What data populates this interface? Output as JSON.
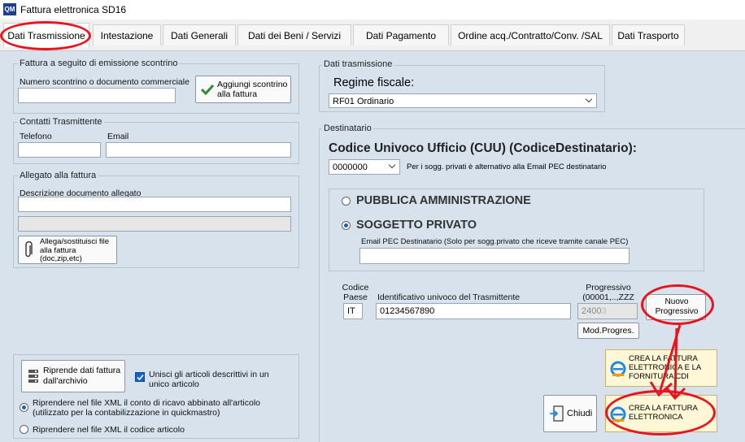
{
  "window": {
    "title": "Fattura elettronica SD16",
    "icon_text": "QM"
  },
  "tabs": [
    {
      "label": "Dati Trasmissione",
      "active": true
    },
    {
      "label": "Intestazione"
    },
    {
      "label": "Dati Generali"
    },
    {
      "label": "Dati dei Beni / Servizi"
    },
    {
      "label": "Dati Pagamento"
    },
    {
      "label": "Ordine acq./Contratto/Conv. /SAL"
    },
    {
      "label": "Dati Trasporto"
    }
  ],
  "scontrino": {
    "title": "Fattura a seguito di emissione scontrino",
    "field_label": "Numero scontrino o documento commerciale",
    "value": "",
    "button_label": "Aggiungi scontrino alla fattura"
  },
  "contatti": {
    "title": "Contatti Trasmittente",
    "telefono_label": "Telefono",
    "telefono_value": "",
    "email_label": "Email",
    "email_value": ""
  },
  "allegato": {
    "title": "Allegato alla fattura",
    "descr_label": "Descrizione documento allegato",
    "descr_value": "",
    "file_value": "",
    "button_label": "Allega/sostituisci file alla fattura (doc,zip,etc)"
  },
  "options": {
    "riprende_button": "Riprende dati fattura dall'archivio",
    "unisci_label": "Unisci gli articoli descrittivi in un unico articolo",
    "unisci_checked": true,
    "radio1_label": "Riprendere nel file XML il  conto di ricavo abbinato all'articolo (utilizzato per la contabilizzazione in quickmastro)",
    "radio1_selected": true,
    "radio2_label": "Riprendere nel file XML il codice articolo",
    "radio2_selected": false
  },
  "dati_trasmissione": {
    "title": "Dati trasmissione",
    "regime_label": "Regime fiscale:",
    "regime_value": "RF01 Ordinario"
  },
  "destinatario": {
    "title": "Destinatario",
    "cuu_label": "Codice Univoco Ufficio (CUU) (CodiceDestinatario):",
    "cuu_value": "0000000",
    "cuu_note": "Per i sogg. privati è alternativo alla Email PEC destinatario",
    "pa_label": "PUBBLICA AMMINISTRAZIONE",
    "pa_selected": false,
    "privato_label": "SOGGETTO PRIVATO",
    "privato_selected": true,
    "pec_label": "Email PEC Destinatario (Solo per sogg.privato che riceve tramite canale PEC)",
    "pec_value": ""
  },
  "trasmittente": {
    "paese_label_1": "Codice",
    "paese_label_2": "Paese",
    "paese_value": "IT",
    "id_label": "Identificativo univoco del Trasmittente",
    "id_value": "01234567890",
    "progr_label_1": "Progressivo",
    "progr_label_2": "(00001,..,ZZZ",
    "progr_value": "2400",
    "progr_value_extra": "3",
    "nuovo_button": "Nuovo Progressivo",
    "mod_button": "Mod.Progres."
  },
  "actions": {
    "crea_fornitura_button": "CREA LA FATTURA ELETTRONICA E LA FORNITURA CDI",
    "crea_button": "CREA LA FATTURA ELETTRONICA",
    "chiudi_button": "Chiudi"
  },
  "colors": {
    "annotation": "#e8141e",
    "panel_bg": "#d7e2ec",
    "radio_accent": "#1565c0"
  }
}
